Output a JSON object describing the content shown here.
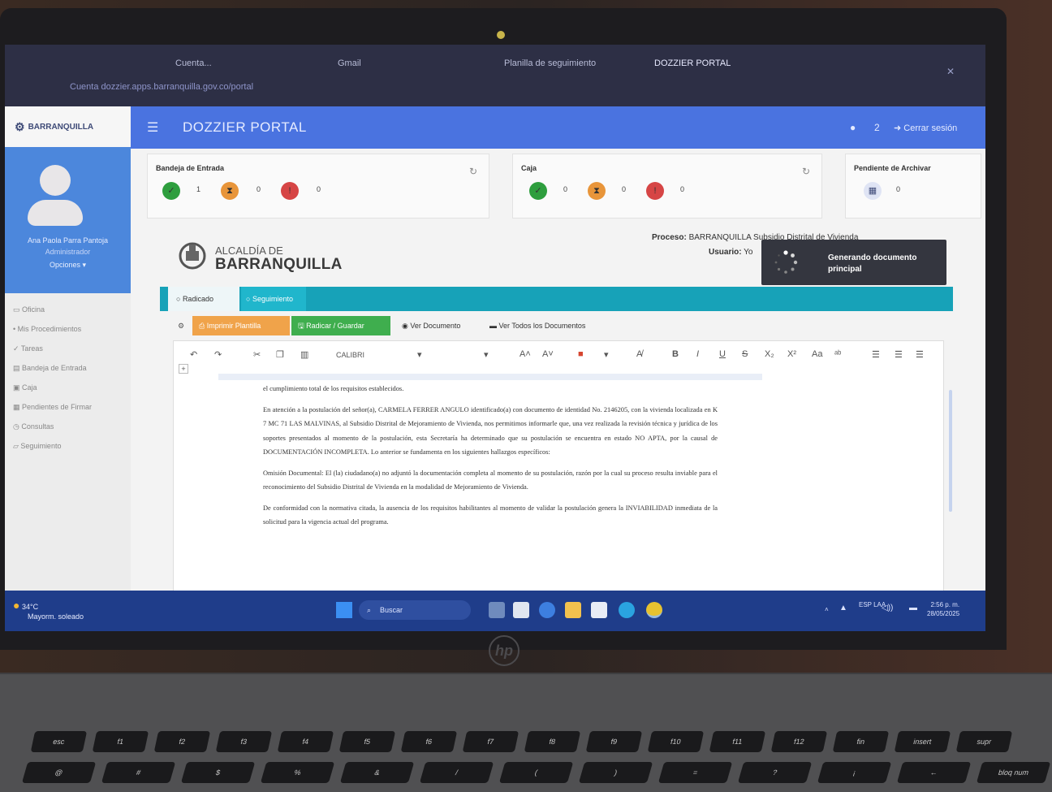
{
  "browser": {
    "tabs": [
      "Cuenta...",
      "Gmail",
      "Planilla de seguimiento",
      "DOZZIER PORTAL"
    ],
    "url": "Cuenta dozzier.apps.barranquilla.gov.co/portal"
  },
  "app": {
    "title": "DOZZIER PORTAL",
    "count_badge": "2",
    "logout_label": "Cerrar sesión",
    "sidebar_logo_text": "BARRANQUILLA"
  },
  "profile": {
    "name": "Ana Paola Parra Pantoja",
    "role": "Administrador",
    "options_label": "Opciones ▾"
  },
  "sidebar": {
    "items": [
      "Oficina",
      "Mis Procedimientos",
      "Tareas",
      "Bandeja de Entrada",
      "Caja",
      "Pendientes de Firmar",
      "Consultas",
      "Seguimiento"
    ]
  },
  "cards": {
    "inbox": {
      "title": "Bandeja de Entrada",
      "counts": [
        "1",
        "0",
        "0"
      ]
    },
    "box": {
      "title": "Caja",
      "counts": [
        "0",
        "0",
        "0"
      ]
    },
    "pending": {
      "title": "Pendiente de Archivar",
      "count": "0"
    }
  },
  "header": {
    "alcaldia_de": "ALCALDÍA DE",
    "alcaldia_name": "BARRANQUILLA",
    "process_label": "Proceso:",
    "process_value": "BARRANQUILLA Subsidio Distrital de Vivienda",
    "user_label": "Usuario:",
    "user_value": "Yo"
  },
  "toast": {
    "text": "Generando documento principal"
  },
  "tabs": {
    "radicado": "Radicado",
    "seguimiento": "Seguimiento"
  },
  "buttons": {
    "print": "Imprimir Plantilla",
    "save": "Radicar / Guardar",
    "view_doc": "Ver Documento",
    "view_all": "Ver Todos los Documentos"
  },
  "editor": {
    "font": "CALIBRI",
    "paragraphs": [
      "el cumplimiento total de los requisitos establecidos.",
      "En atención a la postulación del señor(a), CARMELA FERRER ANGULO identificado(a) con documento de identidad No. 2146205, con la vivienda localizada en K 7 MC 71 LAS MALVINAS, al Subsidio Distrital de Mejoramiento de Vivienda, nos permitimos informarle que, una vez realizada la revisión técnica y jurídica de los soportes presentados al momento de la postulación, esta Secretaría ha determinado que su postulación se encuentra en estado NO APTA, por la causal de DOCUMENTACIÓN INCOMPLETA. Lo anterior se fundamenta en los siguientes hallazgos específicos:",
      "Omisión Documental: El (la) ciudadano(a) no adjuntó la documentación completa al momento de su postulación, razón por la cual su proceso resulta inviable para el reconocimiento del Subsidio Distrital de Vivienda en la modalidad de Mejoramiento de Vivienda.",
      "De conformidad con la normativa citada, la ausencia de los requisitos habilitantes al momento de validar la postulación genera la INVIABILIDAD inmediata de la solicitud para la vigencia actual del programa."
    ]
  },
  "taskbar": {
    "weather_temp": "34°C",
    "weather_desc": "Mayorm. soleado",
    "search": "Buscar",
    "lang": "ESP LAA",
    "time": "2:56 p. m.",
    "date": "28/05/2025"
  },
  "laptop": {
    "brand": "hp"
  },
  "keyboard": {
    "row1": [
      "esc",
      "f1",
      "f2",
      "f3",
      "f4",
      "f5",
      "f6",
      "f7",
      "f8",
      "f9",
      "f10",
      "f11",
      "f12",
      "fin",
      "insert",
      "supr"
    ],
    "row2": [
      "@",
      "#",
      "$",
      "%",
      "&",
      "/",
      "(",
      ")",
      "=",
      "?",
      "¡",
      "←",
      "bloq num"
    ]
  },
  "colors": {
    "topbar": "#4a73e0",
    "profile": "#4c87dc",
    "tabbar": "#17a2b8",
    "print_btn": "#f0a34a",
    "save_btn": "#3fae4e",
    "status_green": "#2e9e3e",
    "status_orange": "#e8953a",
    "status_red": "#d64545"
  }
}
